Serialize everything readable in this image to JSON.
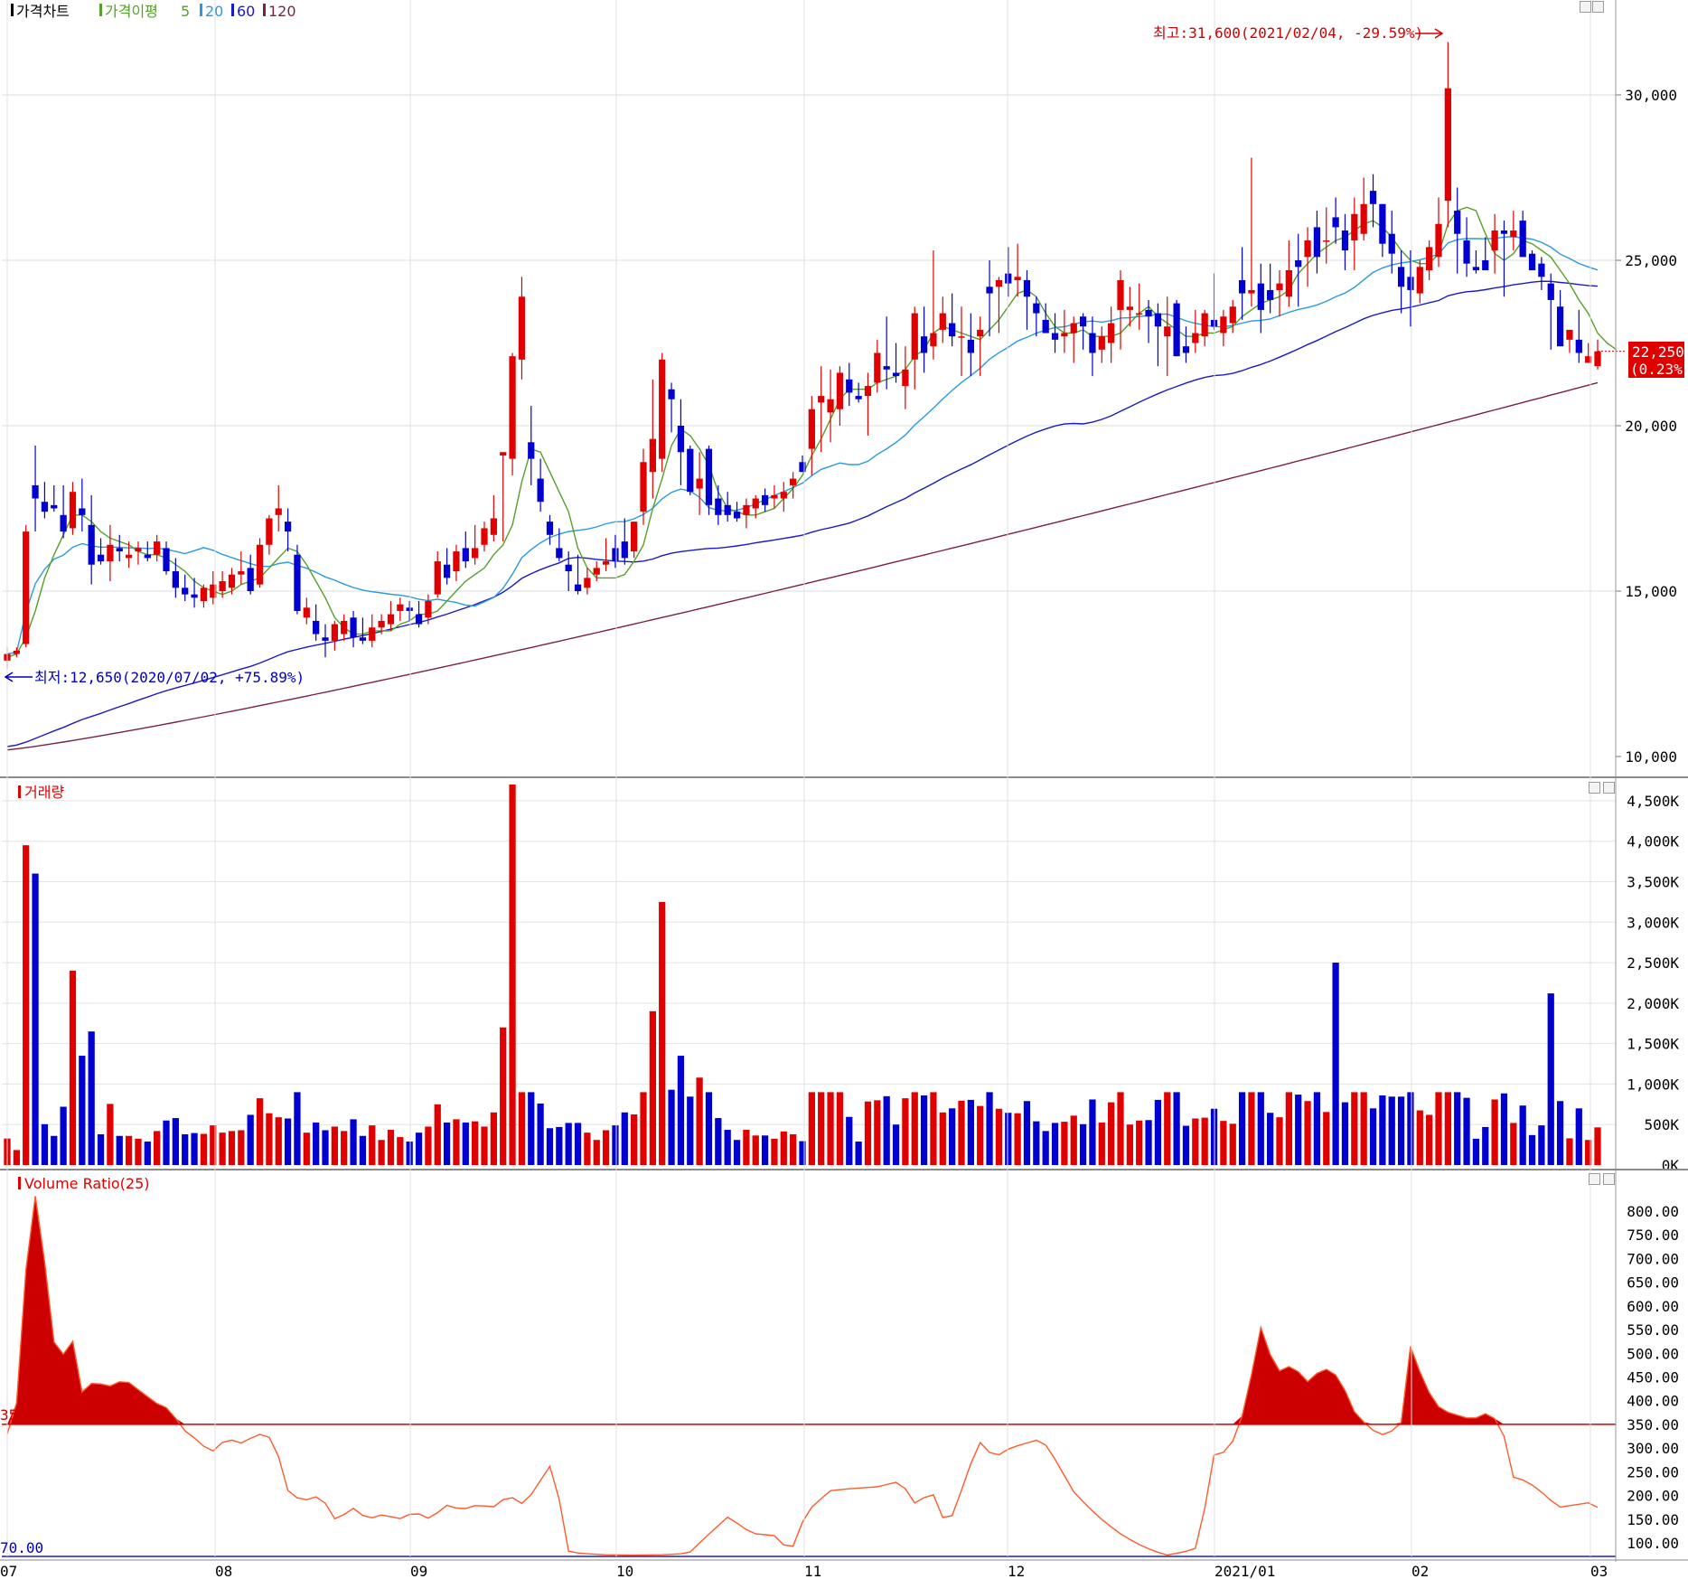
{
  "price_pane": {
    "legend": {
      "chart_label": "가격차트",
      "ma_label": "가격이평",
      "ma_periods": [
        "5",
        "20",
        "60",
        "120"
      ],
      "ma_colors": [
        "#55a02a",
        "#2a9adf",
        "#1a1ac8",
        "#7b1f4a"
      ]
    },
    "high_annotation": "최고:31,600(2021/02/04, -29.59%)",
    "low_annotation": "최저:12,650(2020/07/02, +75.89%)",
    "current_price": "22,250",
    "current_change": "(0.23%)",
    "y_ticks": [
      "30,000",
      "25,000",
      "20,000",
      "15,000",
      "10,000"
    ]
  },
  "volume_pane": {
    "title": "거래량",
    "y_ticks": [
      "4,500K",
      "4,000K",
      "3,500K",
      "3,000K",
      "2,500K",
      "2,000K",
      "1,500K",
      "1,000K",
      "500K",
      "0K"
    ]
  },
  "ratio_pane": {
    "title": "Volume Ratio(25)",
    "threshold_label": "35",
    "min_label": "70.00",
    "y_ticks": [
      "800.00",
      "750.00",
      "700.00",
      "650.00",
      "600.00",
      "550.00",
      "500.00",
      "450.00",
      "400.00",
      "350.00",
      "300.00",
      "250.00",
      "200.00",
      "150.00",
      "100.00"
    ]
  },
  "x_ticks": [
    "07",
    "08",
    "09",
    "10",
    "11",
    "12",
    "2021/01",
    "02",
    "03"
  ],
  "chart_data": {
    "type": "candlestick",
    "title": "",
    "x_range": [
      "2020/07",
      "2021/03"
    ],
    "price_ylim": [
      10000,
      32000
    ],
    "colors": {
      "up": "#e00000",
      "down": "#0000d0"
    },
    "candles": [
      [
        12900,
        13300,
        12650,
        13100
      ],
      [
        13100,
        13300,
        13000,
        13200
      ],
      [
        13400,
        17000,
        13300,
        16800
      ],
      [
        18200,
        19400,
        16800,
        17800
      ],
      [
        17700,
        18300,
        17200,
        17400
      ],
      [
        17600,
        18200,
        17400,
        17500
      ],
      [
        17300,
        18200,
        16600,
        16800
      ],
      [
        16900,
        18300,
        16700,
        18000
      ],
      [
        17500,
        18400,
        16800,
        17300
      ],
      [
        17000,
        17900,
        15200,
        15800
      ],
      [
        16100,
        16600,
        15800,
        15900
      ],
      [
        15900,
        17000,
        15300,
        16400
      ],
      [
        16300,
        16700,
        15900,
        16200
      ],
      [
        16000,
        16500,
        15700,
        16100
      ],
      [
        16200,
        16500,
        15800,
        16300
      ],
      [
        16100,
        16500,
        15900,
        16000
      ],
      [
        16100,
        16700,
        15900,
        16500
      ],
      [
        16300,
        16500,
        15500,
        15600
      ],
      [
        15600,
        16000,
        14800,
        15100
      ],
      [
        15100,
        15500,
        14700,
        14900
      ],
      [
        14900,
        15400,
        14500,
        14800
      ],
      [
        14700,
        15200,
        14500,
        15100
      ],
      [
        14800,
        15600,
        14600,
        15200
      ],
      [
        15000,
        15600,
        14800,
        15300
      ],
      [
        15100,
        15700,
        14900,
        15500
      ],
      [
        15500,
        16200,
        15200,
        15600
      ],
      [
        15700,
        16100,
        14900,
        15000
      ],
      [
        15200,
        16600,
        15100,
        16400
      ],
      [
        16400,
        17300,
        16100,
        17200
      ],
      [
        17300,
        18200,
        16800,
        17500
      ],
      [
        17100,
        17500,
        16200,
        16800
      ],
      [
        16100,
        16400,
        14300,
        14400
      ],
      [
        14200,
        14800,
        14000,
        14500
      ],
      [
        14100,
        14600,
        13500,
        13700
      ],
      [
        13600,
        14000,
        13000,
        13500
      ],
      [
        13500,
        14100,
        13200,
        14000
      ],
      [
        13700,
        14300,
        13500,
        14100
      ],
      [
        14200,
        14400,
        13300,
        13600
      ],
      [
        13600,
        14200,
        13400,
        13500
      ],
      [
        13500,
        14300,
        13300,
        13900
      ],
      [
        13900,
        14300,
        13700,
        14100
      ],
      [
        14000,
        14700,
        13800,
        14300
      ],
      [
        14400,
        14800,
        14100,
        14600
      ],
      [
        14500,
        14700,
        14100,
        14400
      ],
      [
        14300,
        14700,
        13900,
        14000
      ],
      [
        14200,
        14900,
        14000,
        14700
      ],
      [
        14900,
        16200,
        14800,
        15900
      ],
      [
        15800,
        16300,
        15200,
        15400
      ],
      [
        15600,
        16400,
        15300,
        16200
      ],
      [
        16300,
        16800,
        15700,
        15900
      ],
      [
        16000,
        17000,
        15800,
        16300
      ],
      [
        16400,
        17100,
        16200,
        16900
      ],
      [
        16700,
        17900,
        16500,
        17200
      ],
      [
        19100,
        19200,
        16500,
        19200
      ],
      [
        19000,
        22200,
        18500,
        22100
      ],
      [
        22000,
        24500,
        21400,
        23900
      ],
      [
        19500,
        20600,
        18200,
        19000
      ],
      [
        18400,
        19000,
        17400,
        17700
      ],
      [
        17100,
        17300,
        16400,
        16700
      ],
      [
        16300,
        16900,
        15900,
        16000
      ],
      [
        15800,
        16200,
        15000,
        15600
      ],
      [
        15200,
        16100,
        14900,
        15000
      ],
      [
        15100,
        15700,
        14900,
        15400
      ],
      [
        15500,
        15900,
        15300,
        15700
      ],
      [
        15800,
        16600,
        15600,
        15900
      ],
      [
        16300,
        16700,
        15700,
        15900
      ],
      [
        16500,
        17200,
        15800,
        16000
      ],
      [
        16200,
        17100,
        16000,
        17100
      ],
      [
        17400,
        19300,
        17000,
        18900
      ],
      [
        18600,
        21400,
        17800,
        19600
      ],
      [
        19000,
        22200,
        18600,
        22000
      ],
      [
        21100,
        21300,
        19800,
        20800
      ],
      [
        20000,
        20800,
        18200,
        19200
      ],
      [
        19300,
        19400,
        17900,
        18000
      ],
      [
        18100,
        19200,
        17300,
        18400
      ],
      [
        19300,
        19400,
        17300,
        17600
      ],
      [
        17800,
        18200,
        17000,
        17300
      ],
      [
        17600,
        18000,
        17100,
        17300
      ],
      [
        17400,
        17700,
        17100,
        17200
      ],
      [
        17300,
        17800,
        16900,
        17600
      ],
      [
        17500,
        17900,
        17200,
        17800
      ],
      [
        17900,
        18100,
        17400,
        17600
      ],
      [
        17800,
        18200,
        17500,
        17900
      ],
      [
        17800,
        18300,
        17400,
        18000
      ],
      [
        18200,
        18600,
        17800,
        18400
      ],
      [
        18900,
        19100,
        18600,
        18600
      ],
      [
        19300,
        20900,
        18500,
        20500
      ],
      [
        20700,
        21800,
        19200,
        20900
      ],
      [
        20400,
        21700,
        19500,
        20800
      ],
      [
        20500,
        21800,
        20000,
        21600
      ],
      [
        21400,
        21900,
        20600,
        21000
      ],
      [
        20900,
        21300,
        20700,
        20800
      ],
      [
        20900,
        21600,
        19700,
        21200
      ],
      [
        21300,
        22600,
        21000,
        22200
      ],
      [
        21800,
        23300,
        21100,
        21700
      ],
      [
        21600,
        22500,
        21300,
        21500
      ],
      [
        21200,
        22400,
        20500,
        21700
      ],
      [
        22000,
        23600,
        21100,
        23400
      ],
      [
        22700,
        23600,
        21600,
        22200
      ],
      [
        22400,
        25300,
        22000,
        22800
      ],
      [
        22900,
        23900,
        22500,
        23400
      ],
      [
        23100,
        24000,
        22400,
        22700
      ],
      [
        22700,
        23600,
        21500,
        22700
      ],
      [
        22600,
        23400,
        21500,
        22200
      ],
      [
        22700,
        23300,
        21500,
        22900
      ],
      [
        24200,
        25000,
        22700,
        24000
      ],
      [
        24200,
        24500,
        22800,
        24400
      ],
      [
        24600,
        25400,
        23900,
        24300
      ],
      [
        24400,
        25500,
        23900,
        24500
      ],
      [
        24400,
        24700,
        22900,
        23900
      ],
      [
        23700,
        23900,
        22700,
        23400
      ],
      [
        23200,
        23700,
        22900,
        22800
      ],
      [
        22800,
        23400,
        22200,
        22600
      ],
      [
        22700,
        23500,
        22200,
        22800
      ],
      [
        22800,
        23300,
        21900,
        23100
      ],
      [
        23300,
        23400,
        22300,
        23000
      ],
      [
        22800,
        23300,
        21500,
        22200
      ],
      [
        22300,
        23000,
        21900,
        22700
      ],
      [
        22500,
        23600,
        21900,
        23100
      ],
      [
        23500,
        24700,
        22300,
        24400
      ],
      [
        23500,
        24200,
        23000,
        23600
      ],
      [
        23400,
        24300,
        22900,
        23400
      ],
      [
        23500,
        23800,
        22500,
        23300
      ],
      [
        23400,
        23700,
        21800,
        23000
      ],
      [
        22700,
        23900,
        21500,
        23000
      ],
      [
        23700,
        23800,
        22100,
        22100
      ],
      [
        22400,
        23000,
        21900,
        22200
      ],
      [
        22500,
        23500,
        22200,
        22800
      ],
      [
        22700,
        23500,
        22400,
        23400
      ],
      [
        23200,
        24600,
        22900,
        23000
      ],
      [
        22800,
        23500,
        22400,
        23300
      ],
      [
        23100,
        23800,
        22800,
        23600
      ],
      [
        24400,
        25400,
        23200,
        24000
      ],
      [
        24000,
        28100,
        23600,
        24100
      ],
      [
        24300,
        24900,
        22800,
        23500
      ],
      [
        24100,
        24900,
        23400,
        23800
      ],
      [
        24100,
        24700,
        23300,
        24300
      ],
      [
        23900,
        25600,
        23600,
        24700
      ],
      [
        25000,
        25800,
        23600,
        24800
      ],
      [
        25100,
        26000,
        24200,
        25600
      ],
      [
        26000,
        26500,
        24600,
        25100
      ],
      [
        25600,
        26600,
        24900,
        25600
      ],
      [
        26300,
        26900,
        25500,
        26000
      ],
      [
        25900,
        26400,
        24700,
        25300
      ],
      [
        25600,
        26900,
        24700,
        26400
      ],
      [
        25800,
        27500,
        25600,
        26700
      ],
      [
        27100,
        27600,
        26000,
        26700
      ],
      [
        26700,
        26700,
        25100,
        25500
      ],
      [
        25800,
        26500,
        24600,
        25200
      ],
      [
        24800,
        25300,
        23400,
        24200
      ],
      [
        24500,
        25300,
        23000,
        24100
      ],
      [
        24000,
        25000,
        23700,
        24800
      ],
      [
        24700,
        25600,
        24400,
        25400
      ],
      [
        25100,
        26900,
        24800,
        26100
      ],
      [
        26800,
        31600,
        26000,
        30200
      ],
      [
        26500,
        27200,
        24600,
        25800
      ],
      [
        25600,
        26300,
        24500,
        24900
      ],
      [
        24800,
        25300,
        24600,
        24700
      ],
      [
        25000,
        25700,
        24700,
        24700
      ],
      [
        25300,
        26400,
        24600,
        25900
      ],
      [
        25900,
        26200,
        23900,
        25800
      ],
      [
        25700,
        26500,
        25300,
        25900
      ],
      [
        26200,
        26500,
        25200,
        25100
      ],
      [
        25200,
        25300,
        24700,
        24700
      ],
      [
        24900,
        25100,
        24100,
        24500
      ],
      [
        24300,
        24600,
        22300,
        23800
      ],
      [
        23600,
        24100,
        22700,
        22400
      ],
      [
        22600,
        22800,
        22200,
        22900
      ],
      [
        22600,
        23500,
        21900,
        22200
      ],
      [
        21900,
        22500,
        21900,
        22100
      ],
      [
        21800,
        22600,
        21700,
        22250
      ]
    ],
    "ma5_approx": [
      13000,
      13100,
      13600,
      14400,
      15400,
      16100,
      16700,
      17300,
      17300,
      17100,
      16800,
      16600,
      16500,
      16400,
      16200,
      16100,
      16100,
      16000,
      15800,
      15600,
      15300,
      15100,
      15000,
      14900,
      15000,
      15200,
      15300,
      15400,
      15700,
      16000,
      16300,
      16200,
      15800,
      15300,
      14800,
      14200,
      13900,
      13700,
      13700,
      13800,
      13800,
      13800,
      14000,
      14100,
      14300,
      14300,
      14400,
      14700,
      15000,
      15300,
      15500,
      15700,
      16100,
      16400,
      17000,
      18300,
      19300,
      19200,
      18600,
      18000,
      17400,
      16300,
      15700,
      15400,
      15400,
      15400,
      15500,
      15900,
      16400,
      17500,
      18400,
      19400,
      19900,
      19700,
      19300,
      18800,
      18000,
      17500,
      17400,
      17300,
      17300,
      17400,
      17500,
      17800,
      18100,
      18500,
      19100,
      19600,
      20200,
      20800,
      21100,
      21100,
      21100,
      21300,
      21400,
      21500,
      21700,
      22100,
      22300,
      22800,
      23000,
      22900,
      22800,
      22700,
      22600,
      22900,
      23200,
      23600,
      24000,
      24100,
      23900,
      23400,
      23000,
      22800,
      22800,
      22900,
      22700,
      22700,
      22700,
      22800,
      23100,
      23400,
      23600,
      23300,
      23100,
      22900,
      22700,
      22700,
      22800,
      22800,
      22900,
      23000,
      23300,
      23500,
      23700,
      23800,
      23900,
      24100,
      24600,
      24900,
      25200,
      25400,
      25600,
      25700,
      25900,
      26100,
      26200,
      26000,
      25700,
      25300,
      25000,
      24900,
      24900,
      25200,
      26100,
      26500,
      26600,
      26500,
      25800,
      25200,
      25000,
      25200,
      25600,
      25500,
      25300,
      25100,
      24700,
      24300,
      23800,
      23400,
      22800,
      22500,
      22300
    ]
  }
}
